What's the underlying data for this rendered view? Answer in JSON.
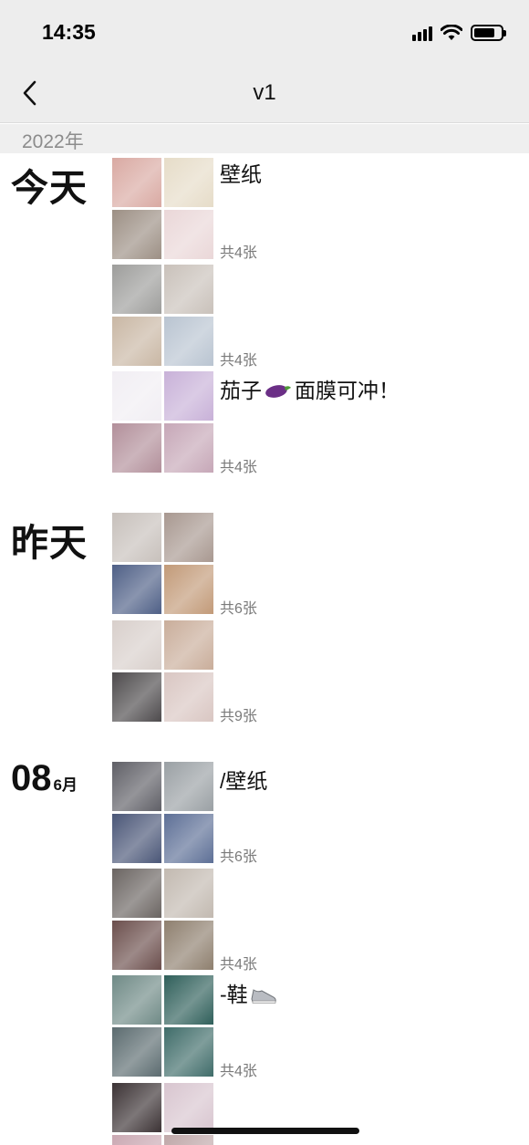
{
  "status_bar": {
    "time": "14:35"
  },
  "nav": {
    "title": "v1"
  },
  "year": "2022年",
  "groups": [
    {
      "date_word": "今天"
    },
    {
      "date_word": "昨天"
    },
    {
      "day": "08",
      "month": "6月"
    }
  ],
  "posts": [
    {
      "caption": "壁纸",
      "count": "共4张",
      "colors": [
        "#d9a9a2",
        "#e6dcc8",
        "#9c8f84",
        "#ead7d8"
      ]
    },
    {
      "caption": "",
      "count": "共4张",
      "colors": [
        "#9d9d9b",
        "#c9c1ba",
        "#c9b7a4",
        "#b9c4d1"
      ]
    },
    {
      "caption_prefix": "茄子",
      "caption_emoji": "eggplant-emoji",
      "caption_suffix": "面膜可冲！",
      "count": "共4张",
      "colors": [
        "#f1eef3",
        "#c8b1d8",
        "#b28f9a",
        "#c6a7b7"
      ]
    },
    {
      "caption": "",
      "count": "共6张",
      "colors": [
        "#c7c0bb",
        "#a89890",
        "#4e5f86",
        "#c29a78"
      ]
    },
    {
      "caption": "",
      "count": "共9张",
      "colors": [
        "#d8cfcb",
        "#c9ad9a",
        "#4d4a4c",
        "#d9c6c2"
      ]
    },
    {
      "caption": "/壁纸",
      "count": "共6张",
      "colors": [
        "#5f5f66",
        "#9aa0a4",
        "#4a5677",
        "#5d6f96"
      ]
    },
    {
      "caption": "",
      "count": "共4张",
      "colors": [
        "#6a6461",
        "#c2b9b0",
        "#6b4e4c",
        "#8e7f6e"
      ]
    },
    {
      "caption_prefix": "-鞋",
      "caption_emoji": "sneaker-emoji",
      "count": "共4张",
      "colors": [
        "#6f8a86",
        "#2f5f5a",
        "#5b6b6f",
        "#3f6c69"
      ]
    },
    {
      "caption": "",
      "count": "",
      "colors": [
        "#3b3234",
        "#d8c5cf",
        "#caa8b2",
        "#bfa7a8"
      ]
    }
  ]
}
